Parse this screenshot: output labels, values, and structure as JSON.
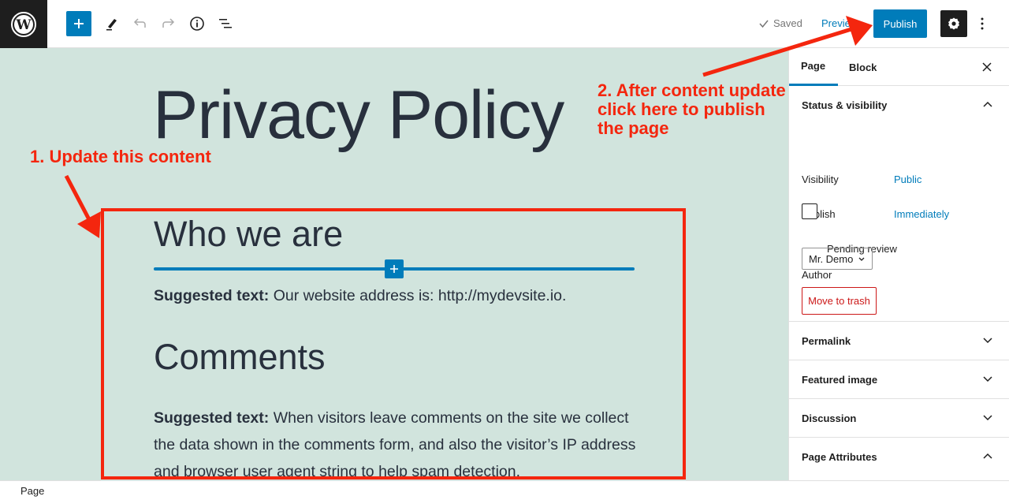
{
  "topbar": {
    "logo_icon": "wordpress-logo-icon",
    "add_block_icon": "plus-icon",
    "tools_icon": "pencil-icon",
    "undo_icon": "undo-icon",
    "redo_icon": "redo-icon",
    "details_icon": "info-icon",
    "list_view_icon": "list-view-icon",
    "saved_label": "Saved",
    "preview_label": "Preview",
    "publish_label": "Publish",
    "settings_icon": "gear-icon",
    "more_icon": "vertical-ellipsis-icon",
    "accent_color": "#007cba"
  },
  "editor": {
    "title": "Privacy Policy",
    "blocks": [
      {
        "type": "heading",
        "text": "Who we are"
      },
      {
        "type": "paragraph",
        "bold": "Suggested text:",
        "text": " Our website address is: http://mydevsite.io."
      },
      {
        "type": "heading",
        "text": "Comments"
      },
      {
        "type": "paragraph",
        "bold": "Suggested text:",
        "text": " When visitors leave comments on the site we collect the data shown in the comments form, and also the visitor’s IP address and browser user agent string to help spam detection."
      }
    ],
    "background_color": "#d1e4dd"
  },
  "annotations": {
    "step1": "1. Update this content",
    "step2_lines": [
      "2. After content update",
      "click here to publish",
      "the page"
    ],
    "color": "#f4260e"
  },
  "sidebar": {
    "tabs": [
      {
        "label": "Page",
        "active": true
      },
      {
        "label": "Block",
        "active": false
      }
    ],
    "close_icon": "close-icon",
    "status_panel": {
      "title": "Status & visibility",
      "expanded": true,
      "visibility_label": "Visibility",
      "visibility_value": "Public",
      "publish_label": "Publish",
      "publish_value": "Immediately",
      "pending_review_label": "Pending review",
      "pending_review_checked": false,
      "author_label": "Author",
      "author_value": "Mr. Demo",
      "trash_label": "Move to trash"
    },
    "panels": [
      {
        "title": "Permalink",
        "expanded": false
      },
      {
        "title": "Featured image",
        "expanded": false
      },
      {
        "title": "Discussion",
        "expanded": false
      },
      {
        "title": "Page Attributes",
        "expanded": true
      }
    ]
  },
  "footer": {
    "breadcrumb": "Page"
  }
}
